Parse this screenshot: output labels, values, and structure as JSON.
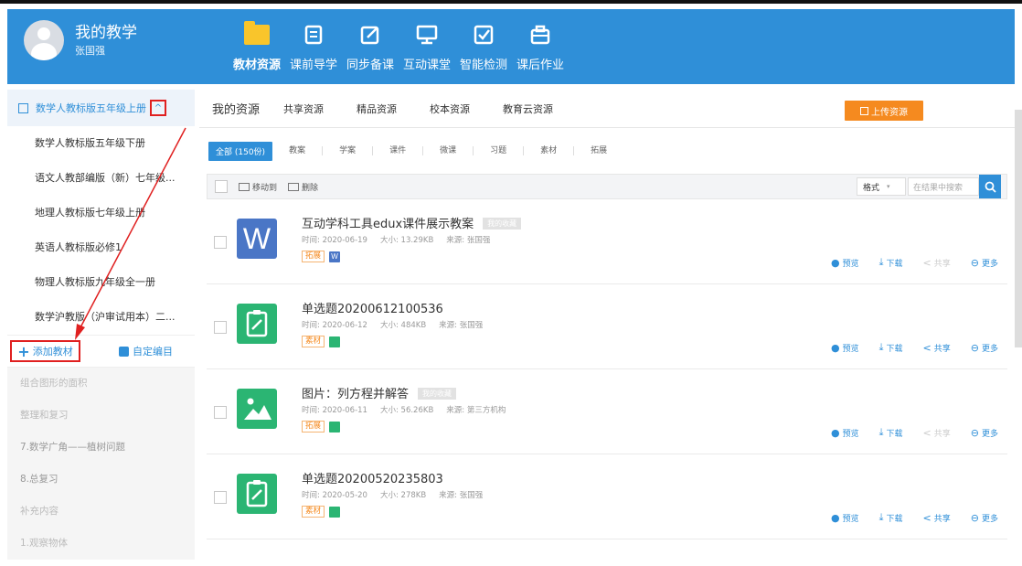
{
  "profile": {
    "title": "我的教学",
    "user": "张国强"
  },
  "nav": [
    {
      "label": "教材资源",
      "icon": "folder-icon",
      "active": true
    },
    {
      "label": "课前导学",
      "icon": "document-icon"
    },
    {
      "label": "同步备课",
      "icon": "edit-icon"
    },
    {
      "label": "互动课堂",
      "icon": "monitor-icon"
    },
    {
      "label": "智能检测",
      "icon": "checkbox-icon"
    },
    {
      "label": "课后作业",
      "icon": "briefcase-icon"
    }
  ],
  "sidebar": {
    "current_book": "数学人教标版五年级上册",
    "toggle": "^",
    "books": [
      "数学人教标版五年级下册",
      "语文人教部编版（新）七年级...",
      "地理人教标版七年级上册",
      "英语人教标版必修1",
      "物理人教标版九年级全一册",
      "数学沪教版（沪审试用本）二..."
    ],
    "add_label": "添加教材",
    "add_icon": "+",
    "edit_label": "自定编目",
    "chapters": [
      "组合图形的面积",
      "整理和复习",
      "7.数学广角——植树问题",
      "8.总复习",
      "补充内容",
      "1.观察物体"
    ]
  },
  "tabs": [
    "我的资源",
    "共享资源",
    "精品资源",
    "校本资源",
    "教育云资源"
  ],
  "upload_label": "上传资源",
  "filters": {
    "active": "全部 (150份)",
    "items": [
      "教案",
      "学案",
      "课件",
      "微课",
      "习题",
      "素材",
      "拓展"
    ]
  },
  "toolbar": {
    "move_label": "移动到",
    "delete_label": "删除",
    "format_label": "格式",
    "format_chevron": "▾",
    "search_placeholder": "在结果中搜索"
  },
  "actions": {
    "preview": "预览",
    "download": "下载",
    "share": "共享",
    "more": "更多"
  },
  "action_glyphs": {
    "preview": "●",
    "download": "⤓",
    "share": "<",
    "more": "⊖"
  },
  "resources": [
    {
      "title": "互动学科工具edux课件展示教案",
      "fav": "我的收藏",
      "time": "时间: 2020-06-19",
      "size": "大小: 13.29KB",
      "source": "来源: 张国强",
      "tag": "拓展",
      "thumb": "W",
      "type": "word",
      "share_enabled": false
    },
    {
      "title": "单选题20200612100536",
      "fav": "",
      "time": "时间: 2020-06-12",
      "size": "大小: 484KB",
      "source": "来源: 张国强",
      "tag": "素材",
      "thumb": "",
      "type": "quiz",
      "share_enabled": true
    },
    {
      "title": "图片：列方程并解答",
      "fav": "我的收藏",
      "time": "时间: 2020-06-11",
      "size": "大小: 56.26KB",
      "source": "来源: 第三方机构",
      "tag": "拓展",
      "thumb": "",
      "type": "image",
      "share_enabled": false
    },
    {
      "title": "单选题20200520235803",
      "fav": "",
      "time": "时间: 2020-05-20",
      "size": "大小: 278KB",
      "source": "来源: 张国强",
      "tag": "素材",
      "thumb": "",
      "type": "quiz",
      "share_enabled": true
    }
  ],
  "colors": {
    "primary": "#2f8fd8",
    "orange": "#f58a1f",
    "highlight": "#e02020",
    "green": "#2bb573",
    "word_blue": "#4a76c6"
  }
}
